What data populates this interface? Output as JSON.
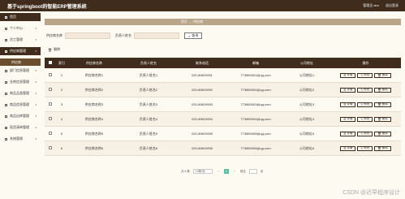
{
  "app": {
    "title": "基于springboot的智能ERP管理系统"
  },
  "topbar": {
    "user_label": "管理员 abo",
    "logout_label": "退出登录"
  },
  "sidebar": {
    "items": [
      {
        "label": "首页",
        "dark": true
      },
      {
        "label": "个人中心"
      },
      {
        "label": "员工管理"
      },
      {
        "label": "供应商管理",
        "dark": true
      },
      {
        "label": "供应商",
        "sub": true
      },
      {
        "label": "部门信息管理"
      },
      {
        "label": "仓库信息管理"
      },
      {
        "label": "商品品类管理"
      },
      {
        "label": "商品信息管理"
      },
      {
        "label": "商品出库管理"
      },
      {
        "label": "现货清单管理"
      },
      {
        "label": "系统管理"
      }
    ]
  },
  "breadcrumb": {
    "home": "首页",
    "sep": "/",
    "current": "供应商"
  },
  "search": {
    "supplier_label": "供应商名称",
    "contact_label": "负责人姓名",
    "button_label": "查询"
  },
  "toolbar": {
    "delete_label": "删除"
  },
  "table": {
    "headers": [
      "索引",
      "供应商名称",
      "负责人姓名",
      "联系电话",
      "邮箱",
      "公司地址",
      "操作"
    ],
    "rows": [
      [
        "1",
        "供应商名称1",
        "负责人姓名1",
        "020-89819991",
        "773890001@qq.com",
        "公司地址1"
      ],
      [
        "2",
        "供应商名称2",
        "负责人姓名2",
        "020-89819992",
        "773890002@qq.com",
        "公司地址2"
      ],
      [
        "3",
        "供应商名称3",
        "负责人姓名3",
        "020-89819993",
        "773890003@qq.com",
        "公司地址3"
      ],
      [
        "4",
        "供应商名称4",
        "负责人姓名4",
        "020-89819994",
        "773890004@qq.com",
        "公司地址4"
      ],
      [
        "5",
        "供应商名称5",
        "负责人姓名5",
        "020-89819995",
        "773890005@qq.com",
        "公司地址5"
      ],
      [
        "6",
        "供应商名称6",
        "负责人姓名6",
        "020-89819996",
        "773890006@qq.com",
        "公司地址6"
      ]
    ],
    "actions": [
      "详情",
      "修改",
      "删除"
    ]
  },
  "pager": {
    "total": "共 6 条",
    "page_size": "10条/页",
    "current": "1",
    "goto": "前往",
    "unit": "页"
  },
  "watermark": "CSDN @迟早程序设计"
}
